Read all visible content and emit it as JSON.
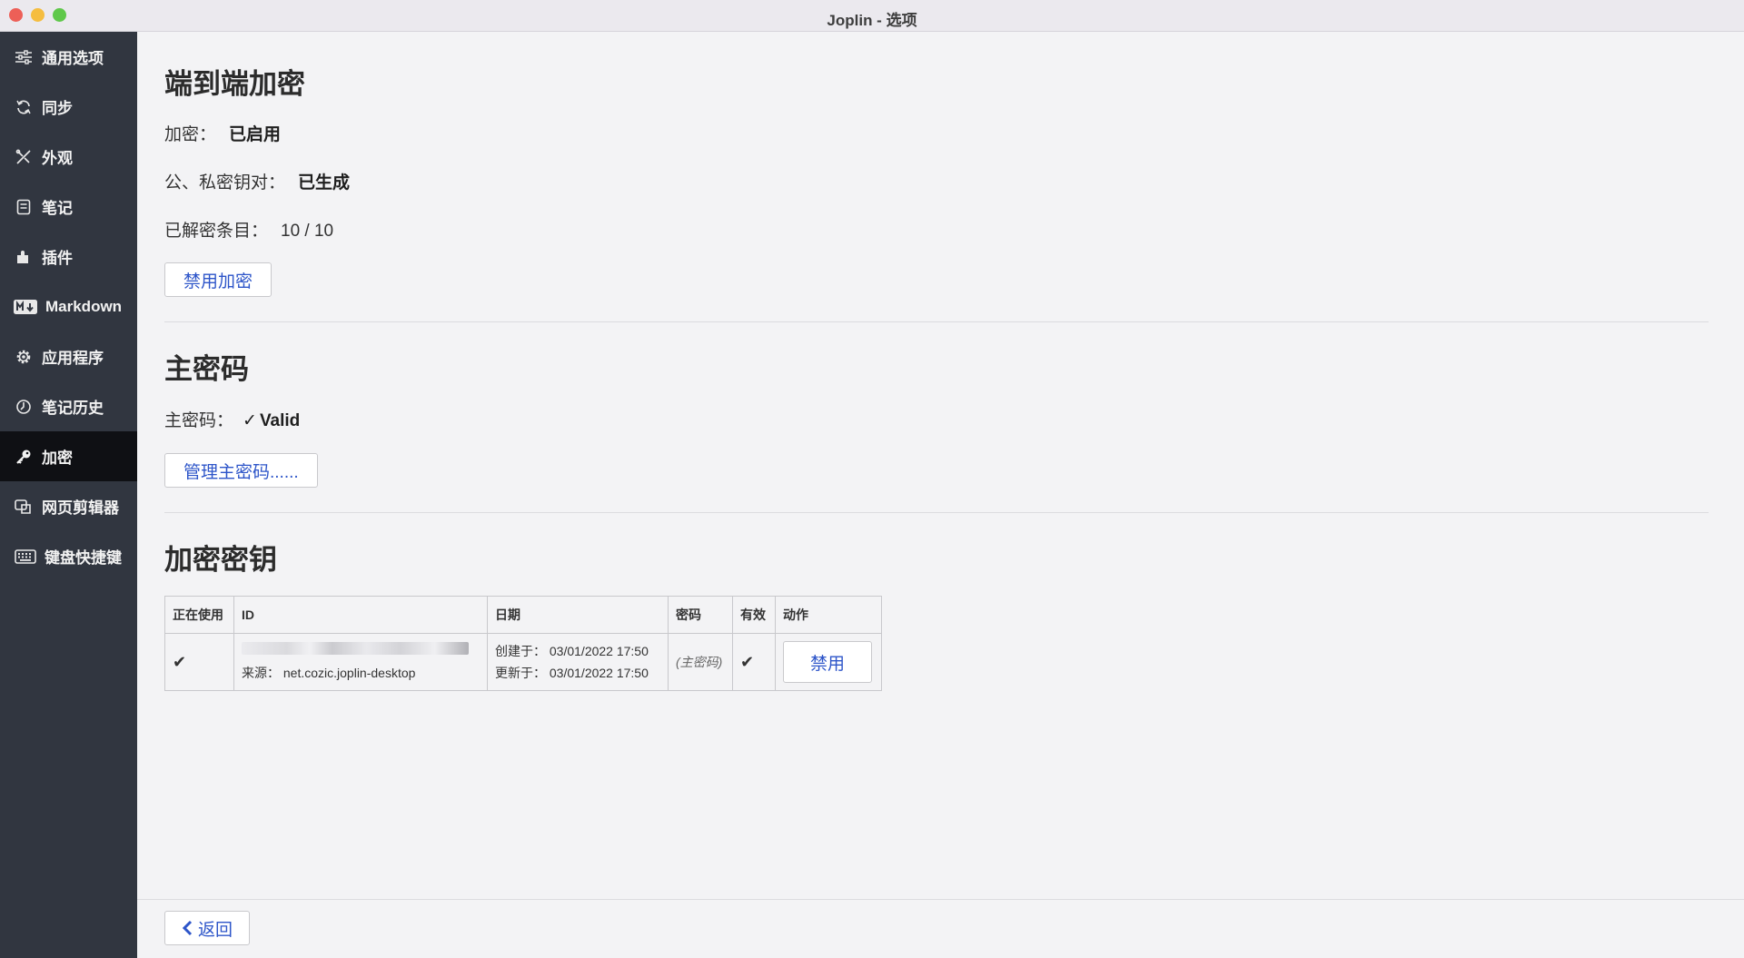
{
  "window": {
    "title": "Joplin - 选项"
  },
  "sidebar": {
    "items": [
      {
        "label": "通用选项",
        "icon": "sliders-icon"
      },
      {
        "label": "同步",
        "icon": "sync-icon"
      },
      {
        "label": "外观",
        "icon": "paint-icon"
      },
      {
        "label": "笔记",
        "icon": "note-icon"
      },
      {
        "label": "插件",
        "icon": "puzzle-icon"
      },
      {
        "label": "Markdown",
        "icon": "markdown-icon"
      },
      {
        "label": "应用程序",
        "icon": "gear-icon"
      },
      {
        "label": "笔记历史",
        "icon": "history-icon"
      },
      {
        "label": "加密",
        "icon": "key-icon",
        "active": true
      },
      {
        "label": "网页剪辑器",
        "icon": "clipper-icon"
      },
      {
        "label": "键盘快捷键",
        "icon": "keyboard-icon"
      }
    ]
  },
  "e2ee": {
    "heading": "端到端加密",
    "encryption_label": "加密：",
    "encryption_value": "已启用",
    "keypair_label": "公、私密钥对：",
    "keypair_value": "已生成",
    "decrypted_label": "已解密条目：",
    "decrypted_value": "10 / 10",
    "disable_button": "禁用加密"
  },
  "master_password": {
    "heading": "主密码",
    "label": "主密码：",
    "status_check": "✓",
    "status_value": "Valid",
    "manage_button": "管理主密码......"
  },
  "keys": {
    "heading": "加密密钥",
    "columns": [
      "正在使用",
      "ID",
      "日期",
      "密码",
      "有效",
      "动作"
    ],
    "rows": [
      {
        "in_use": "✔",
        "source_label": "来源：",
        "source_value": "net.cozic.joplin-desktop",
        "created_label": "创建于：",
        "created_value": "03/01/2022 17:50",
        "updated_label": "更新于：",
        "updated_value": "03/01/2022 17:50",
        "password": "(主密码)",
        "valid": "✔",
        "action": "禁用"
      }
    ]
  },
  "footer": {
    "back_button": "返回"
  }
}
